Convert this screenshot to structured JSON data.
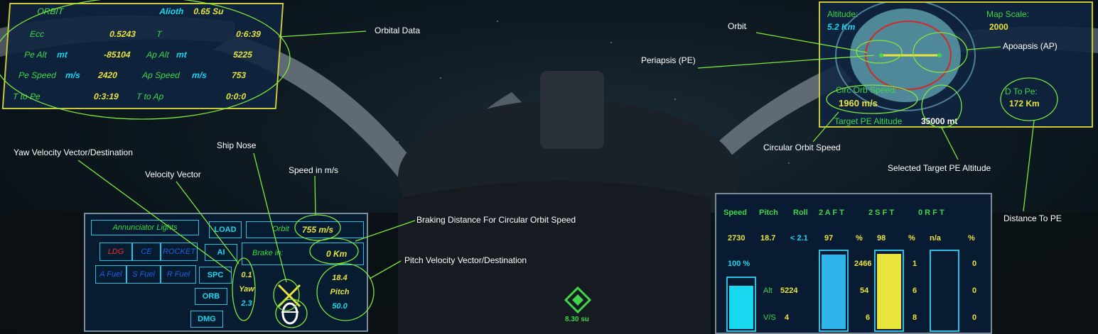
{
  "orbit_panel": {
    "title": "ORBIT",
    "body_name": "Alioth",
    "body_gravity": "0.65 Su",
    "ecc_label": "Ecc",
    "ecc_value": "0.5243",
    "t_label": "T",
    "t_value": "0:6:39",
    "pe_alt_label": "Pe Alt",
    "pe_alt_unit": "mt",
    "pe_alt_value": "-85104",
    "ap_alt_label": "Ap Alt",
    "ap_alt_unit": "mt",
    "ap_alt_value": "5225",
    "pe_speed_label": "Pe Speed",
    "pe_speed_unit": "m/s",
    "pe_speed_value": "2420",
    "ap_speed_label": "Ap Speed",
    "ap_speed_unit": "m/s",
    "ap_speed_value": "753",
    "t_to_pe_label": "T to Pe",
    "t_to_pe_value": "0:3:19",
    "t_to_ap_label": "T to Ap",
    "t_to_ap_value": "0:0:0"
  },
  "map_panel": {
    "altitude_label": "Altitude:",
    "altitude_value": "5.2 Km",
    "map_scale_label": "Map Scale:",
    "map_scale_value": "2000",
    "circ_speed_label": "Circ Orb Speed:",
    "circ_speed_value": "1960 m/s",
    "d_to_pe_label": "D To Pe:",
    "d_to_pe_value": "172 Km",
    "target_pe_label": "Target PE Altitude",
    "target_pe_value": "35000 mt"
  },
  "left_console": {
    "annunciator_title": "Annunciator Lights",
    "lights": [
      "LDG",
      "CE",
      "ROCKET",
      "A Fuel",
      "S Fuel",
      "R Fuel"
    ],
    "buttons": [
      "LOAD",
      "AI",
      "SPC",
      "ORB",
      "DMG"
    ],
    "orbit_label": "Orbit",
    "orbit_speed": "755 m/s",
    "brake_label": "Brake in:",
    "brake_value": "0 Km",
    "yaw_top": "0.1",
    "yaw_label": "Yaw",
    "yaw_bottom": "2.3",
    "pitch_top": "18.4",
    "pitch_label": "Pitch",
    "pitch_bottom": "50.0"
  },
  "right_console": {
    "headers": [
      "Speed",
      "Pitch",
      "Roll",
      "2 A F T",
      "2 S F T",
      "0 R F T"
    ],
    "speed": "2730",
    "pitch": "18.7",
    "roll": "< 2.1",
    "aft_pct": "97",
    "aft_pct_sym": "%",
    "sft_pct": "98",
    "sft_pct_sym": "%",
    "rft_pct": "n/a",
    "rft_pct_sym": "%",
    "throttle": "100 %",
    "alt_label": "Alt",
    "alt_value": "5224",
    "vs_label": "V/S",
    "vs_value": "4",
    "col1": [
      "2466",
      "54",
      "6"
    ],
    "col2": [
      "1",
      "6",
      "8"
    ],
    "col3": [
      "0",
      "0",
      "0"
    ],
    "gauges": {
      "throttle": 0.88,
      "aft": 0.97,
      "sft": 0.98,
      "rft": 0
    }
  },
  "center_marker": {
    "distance": "8.30 su"
  },
  "annotations": {
    "orbital_data": "Orbital Data",
    "orbit": "Orbit",
    "periapsis": "Periapsis (PE)",
    "apoapsis": "Apoapsis (AP)",
    "circ_orbit_speed": "Circular Orbit Speed",
    "selected_target": "Selected Target PE Altitude",
    "distance_to_pe": "Distance To PE",
    "yaw_vector": "Yaw Velocity Vector/Destination",
    "ship_nose": "Ship Nose",
    "velocity_vector": "Velocity Vector",
    "speed_ms": "Speed in m/s",
    "braking": "Braking Distance For Circular Orbit Speed",
    "pitch_vector": "Pitch Velocity Vector/Destination"
  },
  "colors": {
    "accent_yellow": "#e8e43c",
    "accent_green": "#3fd64a",
    "accent_cyan": "#18d8ef",
    "annot_line": "#7ee83c"
  }
}
